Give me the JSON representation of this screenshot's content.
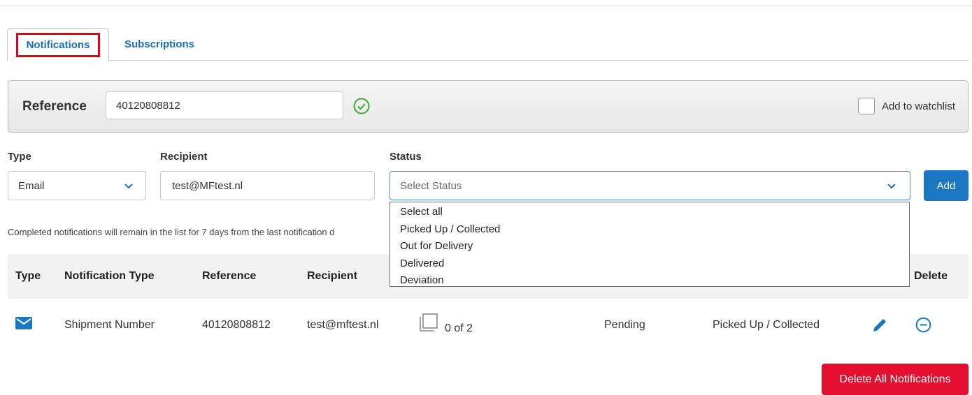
{
  "tabs": {
    "notifications": "Notifications",
    "subscriptions": "Subscriptions"
  },
  "reference": {
    "label": "Reference",
    "value": "40120808812",
    "watchlist_label": "Add to watchlist"
  },
  "form": {
    "type_label": "Type",
    "type_value": "Email",
    "recipient_label": "Recipient",
    "recipient_value": "test@MFtest.nl",
    "status_label": "Status",
    "status_placeholder": "Select Status",
    "add_button": "Add"
  },
  "status_options": [
    "Select all",
    "Picked Up / Collected",
    "Out for Delivery",
    "Delivered",
    "Deviation"
  ],
  "note": "Completed notifications will remain in the list for 7 days from the last notification d",
  "table": {
    "headers": {
      "type": "Type",
      "notification_type": "Notification Type",
      "reference": "Reference",
      "recipient": "Recipient",
      "delete": "Delete"
    },
    "row": {
      "notification_type": "Shipment Number",
      "reference": "40120808812",
      "recipient": "test@mftest.nl",
      "count": "0 of 2",
      "status": "Pending",
      "event": "Picked Up / Collected"
    }
  },
  "delete_all_button": "Delete All Notifications",
  "colors": {
    "accent": "#1a78c2",
    "danger": "#e0102e",
    "success": "#3aaa35"
  }
}
